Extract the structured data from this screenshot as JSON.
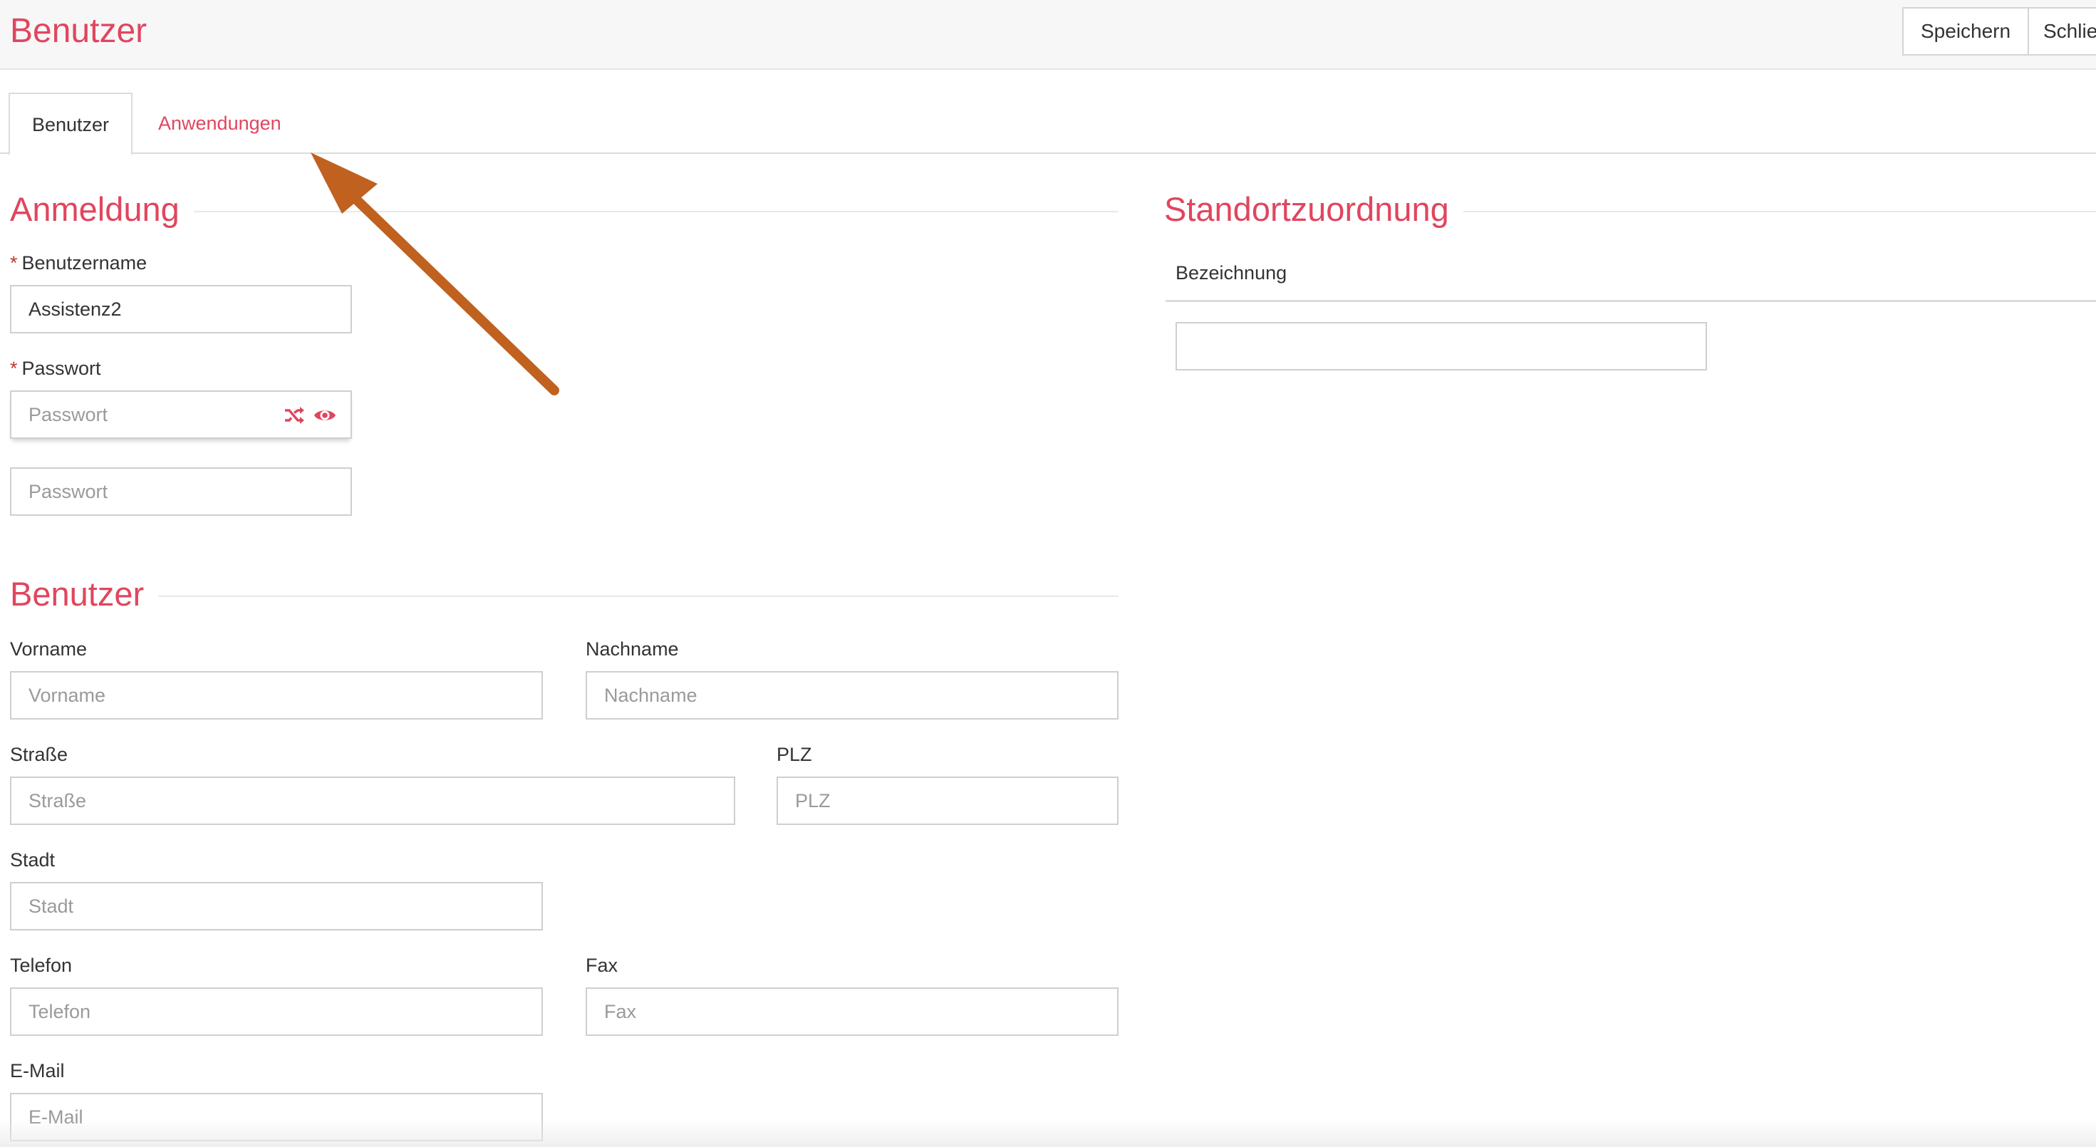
{
  "header": {
    "title": "Benutzer",
    "save_label": "Speichern",
    "close_label": "Schlie"
  },
  "tabs": [
    {
      "label": "Benutzer",
      "active": true
    },
    {
      "label": "Anwendungen",
      "active": false
    }
  ],
  "login": {
    "title": "Anmeldung",
    "username_label": "Benutzername",
    "username_value": "Assistenz2",
    "password_label": "Passwort",
    "password_placeholder": "Passwort",
    "password_confirm_placeholder": "Passwort",
    "required_marker": "*"
  },
  "user": {
    "title": "Benutzer",
    "firstname_label": "Vorname",
    "firstname_placeholder": "Vorname",
    "lastname_label": "Nachname",
    "lastname_placeholder": "Nachname",
    "street_label": "Straße",
    "street_placeholder": "Straße",
    "zip_label": "PLZ",
    "zip_placeholder": "PLZ",
    "city_label": "Stadt",
    "city_placeholder": "Stadt",
    "phone_label": "Telefon",
    "phone_placeholder": "Telefon",
    "fax_label": "Fax",
    "fax_placeholder": "Fax",
    "email_label": "E-Mail",
    "email_placeholder": "E-Mail"
  },
  "location": {
    "title": "Standortzuordnung",
    "column_label": "Bezeichnung"
  },
  "icons": {
    "shuffle": "shuffle-icon",
    "eye": "eye-icon"
  },
  "colors": {
    "accent": "#e0465e",
    "annotation_arrow": "#c0611f"
  }
}
